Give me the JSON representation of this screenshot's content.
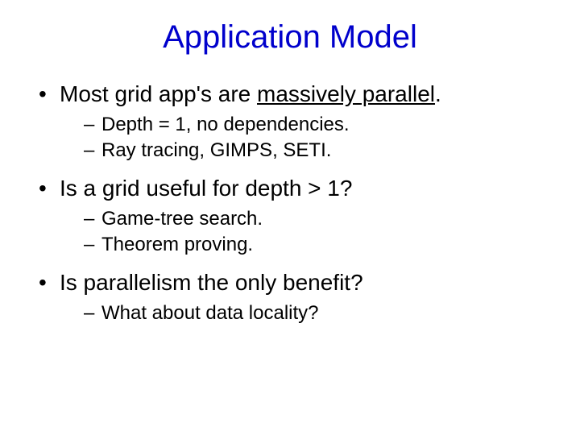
{
  "title": "Application Model",
  "bullets": [
    {
      "prefix": "Most grid app's are ",
      "emph": "massively parallel",
      "suffix": ".",
      "sub": [
        "Depth = 1, no dependencies.",
        "Ray tracing, GIMPS, SETI."
      ]
    },
    {
      "text": "Is a grid useful for depth > 1?",
      "sub": [
        "Game-tree search.",
        "Theorem proving."
      ]
    },
    {
      "text": "Is parallelism the only benefit?",
      "sub": [
        "What about data locality?"
      ]
    }
  ]
}
